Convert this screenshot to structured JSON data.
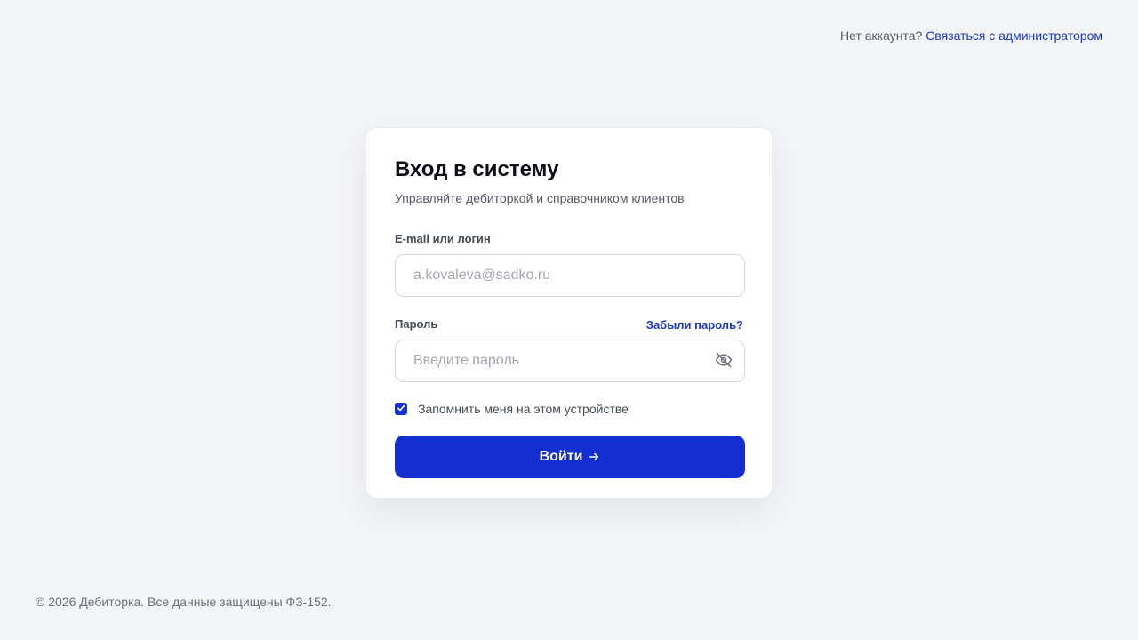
{
  "header": {
    "no_account_text": "Нет аккаунта?",
    "contact_admin_link": "Связаться с администратором"
  },
  "login": {
    "title": "Вход в систему",
    "subtitle": "Управляйте дебиторкой и справочником клиентов",
    "email_label": "E-mail или логин",
    "email_placeholder": "a.kovaleva@sadko.ru",
    "email_value": "",
    "password_label": "Пароль",
    "forgot_link": "Забыли пароль?",
    "password_placeholder": "Введите пароль",
    "password_value": "",
    "password_toggle_icon": "eye-off-icon",
    "remember_label": "Запомнить меня на этом устройстве",
    "remember_checked": true,
    "submit_label": "Войти",
    "submit_icon": "arrow-right-icon"
  },
  "footer": {
    "copyright": "© 2026 Дебиторка. Все данные защищены ФЗ-152."
  },
  "colors": {
    "accent": "#132fd1",
    "link": "#1b36c7",
    "background": "#f4f5f7"
  }
}
